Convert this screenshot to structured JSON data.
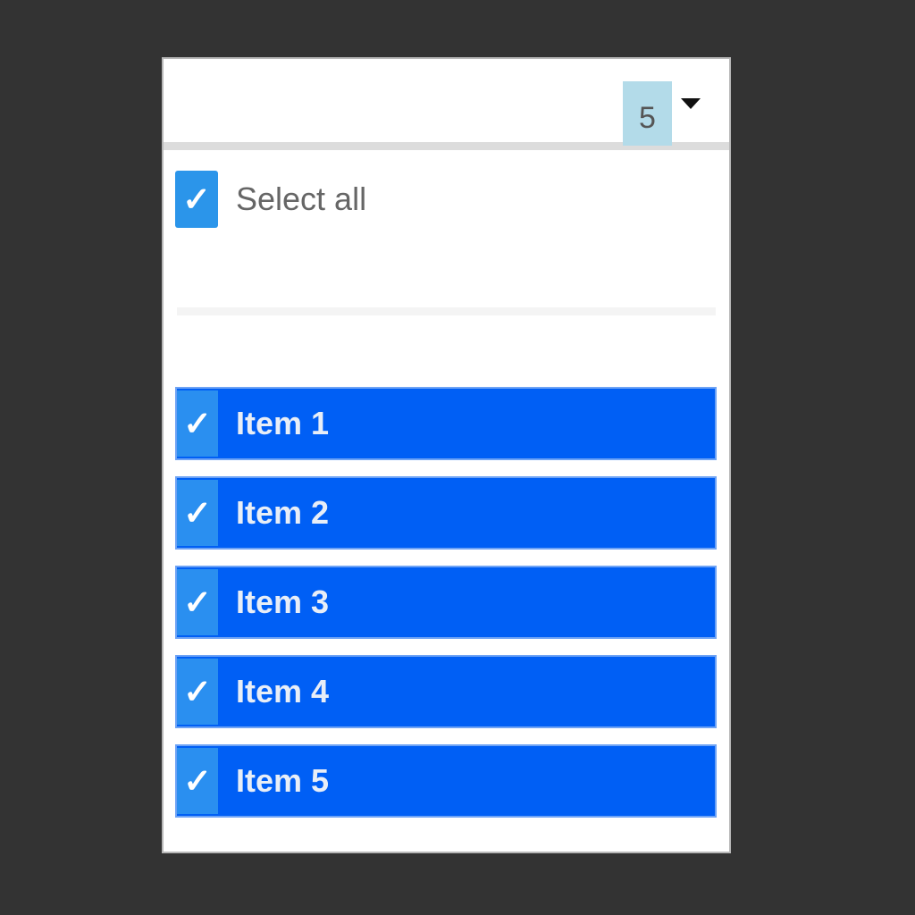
{
  "header": {
    "selected_count": "5"
  },
  "select_all": {
    "label": "Select all",
    "checked": true
  },
  "items": [
    {
      "label": "Item 1",
      "checked": true
    },
    {
      "label": "Item 2",
      "checked": true
    },
    {
      "label": "Item 3",
      "checked": true
    },
    {
      "label": "Item 4",
      "checked": true
    },
    {
      "label": "Item 5",
      "checked": true
    }
  ],
  "colors": {
    "background": "#333333",
    "selected_row": "#005ff5",
    "checkbox": "#2b95ea",
    "count_badge": "#b3dbe9"
  },
  "icons": {
    "checkmark": "check-icon",
    "dropdown": "caret-down-icon"
  }
}
